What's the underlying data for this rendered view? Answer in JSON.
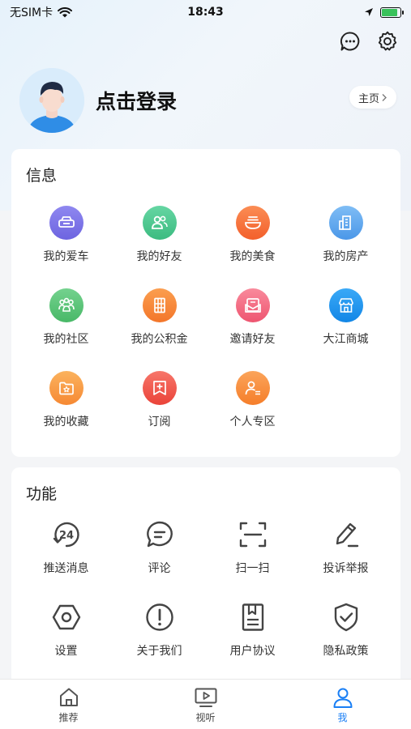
{
  "status": {
    "carrier": "无SIM卡",
    "time": "18:43",
    "battery_level": 0.85
  },
  "profile": {
    "login_text": "点击登录",
    "home_label": "主页"
  },
  "top_icons": [
    "message-icon",
    "gear-icon"
  ],
  "info_section": {
    "title": "信息",
    "items": [
      {
        "label": "我的爱车",
        "icon": "car-icon",
        "color": "#7b74e8"
      },
      {
        "label": "我的好友",
        "icon": "friends-icon",
        "color": "#4cc68f"
      },
      {
        "label": "我的美食",
        "icon": "food-icon",
        "color": "#f8723c"
      },
      {
        "label": "我的房产",
        "icon": "building-icon",
        "color": "#5aa6f0"
      },
      {
        "label": "我的社区",
        "icon": "community-icon",
        "color": "#5bc47a"
      },
      {
        "label": "我的公积金",
        "icon": "fund-icon",
        "color": "#f7862e"
      },
      {
        "label": "邀请好友",
        "icon": "invite-icon",
        "color": "#f46b82"
      },
      {
        "label": "大江商城",
        "icon": "shop-icon",
        "color": "#1e94ef"
      },
      {
        "label": "我的收藏",
        "icon": "collect-icon",
        "color": "#f89a3a"
      },
      {
        "label": "订阅",
        "icon": "subscribe-icon",
        "color": "#f25a4f"
      },
      {
        "label": "个人专区",
        "icon": "personal-icon",
        "color": "#f8892f"
      }
    ]
  },
  "func_section": {
    "title": "功能",
    "items": [
      {
        "label": "推送消息",
        "icon": "push-24-icon"
      },
      {
        "label": "评论",
        "icon": "comment-icon"
      },
      {
        "label": "扫一扫",
        "icon": "scan-icon"
      },
      {
        "label": "投诉举报",
        "icon": "pencil-icon"
      },
      {
        "label": "设置",
        "icon": "hexagon-icon"
      },
      {
        "label": "关于我们",
        "icon": "info-icon"
      },
      {
        "label": "用户协议",
        "icon": "document-icon"
      },
      {
        "label": "隐私政策",
        "icon": "shield-check-icon"
      }
    ]
  },
  "tabs": [
    {
      "label": "推荐",
      "icon": "home-icon",
      "active": false
    },
    {
      "label": "视听",
      "icon": "video-icon",
      "active": false
    },
    {
      "label": "我",
      "icon": "user-icon",
      "active": true
    }
  ],
  "colors": {
    "accent": "#1a7ff5",
    "line_icon": "#444444"
  }
}
